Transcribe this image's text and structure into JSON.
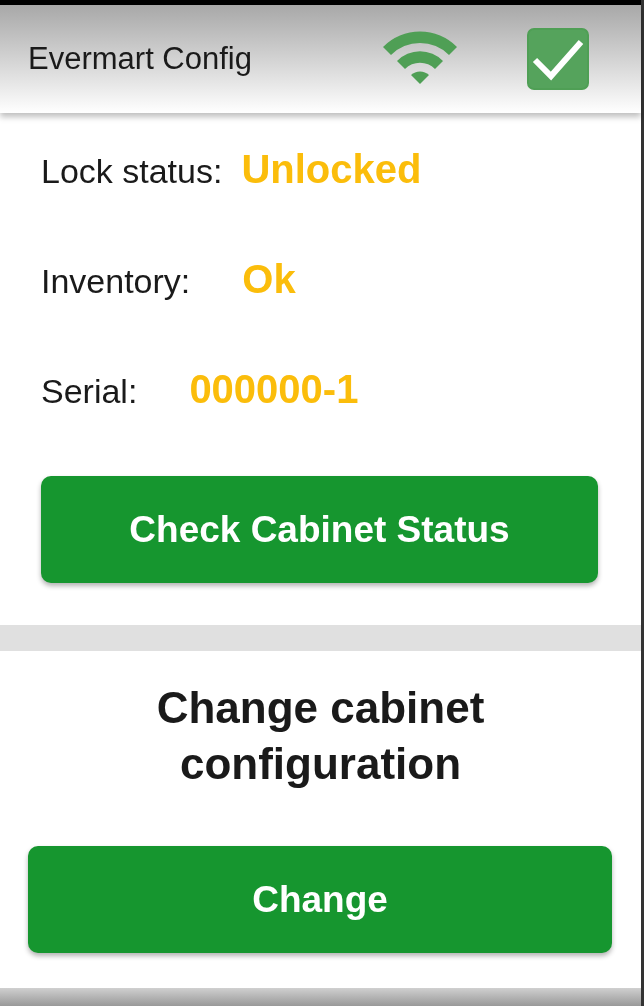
{
  "header": {
    "title": "Evermart Config",
    "wifi_connected": true,
    "checked": true
  },
  "status": [
    {
      "label": "Lock status:",
      "value": "Unlocked"
    },
    {
      "label": "Inventory:",
      "value": "Ok"
    },
    {
      "label": "Serial:",
      "value": "000000-1"
    }
  ],
  "check_button": "Check Cabinet Status",
  "config": {
    "heading": "Change cabinet configuration",
    "button": "Change"
  }
}
